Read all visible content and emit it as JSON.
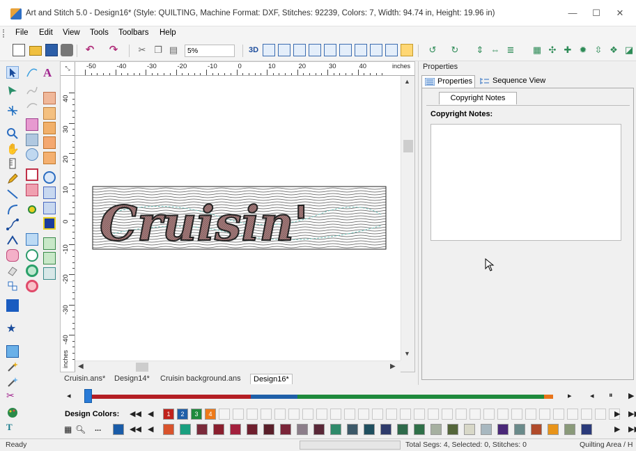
{
  "window": {
    "title": "Art and Stitch 5.0 - Design16* (Style: QUILTING, Machine Format: DXF, Stitches: 92239, Colors: 7, Width: 94.74 in, Height: 19.96 in)",
    "minimize": "—",
    "maximize": "☐",
    "close": "✕"
  },
  "menu": {
    "items": [
      "File",
      "Edit",
      "View",
      "Tools",
      "Toolbars",
      "Help"
    ]
  },
  "toolbar": {
    "zoom_value": "5%",
    "btn_3d": "3D"
  },
  "rulers": {
    "horizontal_labels": [
      "-50",
      "-40",
      "-30",
      "-20",
      "-10",
      "0",
      "10",
      "20",
      "30",
      "40"
    ],
    "horizontal_unit": "inches",
    "vertical_labels": [
      "40",
      "30",
      "20",
      "10",
      "0",
      "-10",
      "-20",
      "-30",
      "-40"
    ],
    "vertical_unit": "inches"
  },
  "canvas": {
    "design_text": "Cruisin'"
  },
  "document_tabs": [
    "Cruisin.ans*",
    "Design14*",
    "Cruisin background.ans",
    "Design16*"
  ],
  "active_document_tab": 3,
  "properties": {
    "header": "Properties",
    "tabs": [
      "Properties",
      "Sequence View"
    ],
    "subtab": "Copyright Notes",
    "group_title": "Copyright Notes:",
    "notes_value": ""
  },
  "sequence": {
    "segments": [
      {
        "color": "#b41e24",
        "fraction": 0.35
      },
      {
        "color": "#1f5fa8",
        "fraction": 0.1
      },
      {
        "color": "#1e8a3c",
        "fraction": 0.53
      },
      {
        "color": "#e8741a",
        "fraction": 0.02
      }
    ]
  },
  "design_colors": {
    "label": "Design Colors:",
    "numbered": [
      {
        "num": "1",
        "color": "#c0221c"
      },
      {
        "num": "2",
        "color": "#1f5fa8"
      },
      {
        "num": "3",
        "color": "#1e8a3c"
      },
      {
        "num": "4",
        "color": "#ee7a1a"
      }
    ]
  },
  "palette": {
    "more_label": "...",
    "colors": [
      "#d9532c",
      "#1aa080",
      "#7a2a3a",
      "#8a1f2e",
      "#a3203d",
      "#6f1f2e",
      "#5a1f2a",
      "#7a2438",
      "#8c7e8a",
      "#5a2838",
      "#2f8a6a",
      "#3c5868",
      "#1f4f5f",
      "#2e3b6b",
      "#2e6a4a",
      "#2f7048",
      "#a6b0a0",
      "#54663a",
      "#d8d8c8",
      "#a8b8c0",
      "#4a2878",
      "#6a8a8a",
      "#b04a2a",
      "#e8941a",
      "#8a9a7a",
      "#2a3a7a"
    ]
  },
  "status": {
    "ready": "Ready",
    "info": "Total Segs: 4, Selected: 0, Stitches: 0",
    "area": "Quilting Area / H"
  }
}
